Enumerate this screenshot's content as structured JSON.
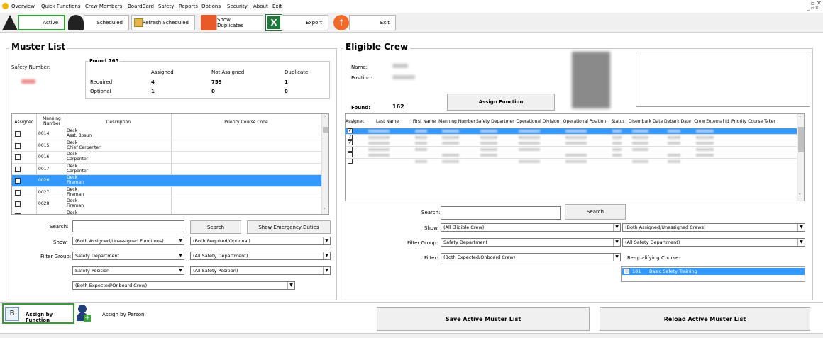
{
  "menu": {
    "items": [
      "Overview",
      "Quick Functions",
      "Crew Members",
      "BoardCard",
      "Safety",
      "Reports",
      "Options",
      "Security",
      "About",
      "Exit"
    ]
  },
  "toolbar": {
    "active_label": "Active",
    "scheduled_label": "Scheduled",
    "refresh_label": "Refresh Scheduled",
    "duplicates_label": "Show Duplicates",
    "export_label": "Export",
    "exit_label": "Exit"
  },
  "muster": {
    "title": "Muster List",
    "safety_number_label": "Safety Number:",
    "found_label": "Found 765",
    "stats": {
      "col_assigned": "Assigned",
      "col_not_assigned": "Not Assigned",
      "col_duplicate": "Duplicate",
      "row_required": "Required",
      "row_optional": "Optional",
      "req_assigned": "4",
      "req_not_assigned": "759",
      "req_duplicate": "1",
      "opt_assigned": "1",
      "opt_not_assigned": "0",
      "opt_duplicate": "0"
    },
    "table": {
      "col_assigned": "Assigned",
      "col_manning": "Manning Number",
      "col_description": "Description",
      "col_priority": "Priority Course Code",
      "rows": [
        {
          "num": "0014",
          "line1": "Deck",
          "line2": "Asst. Bosun",
          "selected": false
        },
        {
          "num": "0015",
          "line1": "Deck",
          "line2": "Chief Carpenter",
          "selected": false
        },
        {
          "num": "0016",
          "line1": "Deck",
          "line2": "Carpenter",
          "selected": false
        },
        {
          "num": "0017",
          "line1": "Deck",
          "line2": "Carpenter",
          "selected": false
        },
        {
          "num": "0026",
          "line1": "Deck",
          "line2": "Fireman",
          "selected": true
        },
        {
          "num": "0027",
          "line1": "Deck",
          "line2": "Fireman",
          "selected": false
        },
        {
          "num": "0028",
          "line1": "Deck",
          "line2": "Fireman",
          "selected": false
        },
        {
          "num": "",
          "line1": "Deck",
          "line2": "",
          "selected": false
        }
      ]
    },
    "search_label": "Search:",
    "search_button": "Search",
    "emergency_button": "Show Emergency Duties",
    "show_label": "Show:",
    "show_value1": "(Both Assigned/Unassigned Functions)",
    "show_value2": "(Both Required/Optional)",
    "filter_group_label": "Filter Group:",
    "filter_value1": "Safety Department",
    "filter_value2": "(All Safety Department)",
    "filter_value3": "Safety Position",
    "filter_value4": "(All Safety Position)",
    "filter_value5": "(Both Expected/Onboard Crew)"
  },
  "crew": {
    "title": "Eligible Crew",
    "name_label": "Name:",
    "position_label": "Position:",
    "found_label": "Found:",
    "found_value": "162",
    "assign_button": "Assign Function",
    "columns": [
      "Assigned",
      "Last Name",
      "First Name",
      "Manning Number",
      "Safety Department",
      "Operational Division",
      "Operational Position",
      "Status",
      "Disembark Date",
      "Debark Date",
      "Crew External Id",
      "Priority Course Taken"
    ],
    "rows": [
      {
        "checked": true,
        "selected": true
      },
      {
        "checked": true,
        "selected": false
      },
      {
        "checked": true,
        "selected": false
      },
      {
        "checked": false,
        "selected": false
      },
      {
        "checked": false,
        "selected": false
      },
      {
        "checked": false,
        "selected": false
      }
    ],
    "search_label": "Search:",
    "search_button": "Search",
    "show_label": "Show:",
    "show_value1": "(All Eligible Crew)",
    "show_value2": "(Both Assigned/Unassigned Crews)",
    "filter_group_label": "Filter Group:",
    "filter_value1": "Safety Department",
    "filter_value2": "(All Safety Department)",
    "filter_label": "Filter:",
    "filter_value3": "(Both Expected/Onboard Crew)",
    "requalifying_label": "Re-qualifying Course:",
    "course_code": "181",
    "course_name": "Basic Safety Training"
  },
  "bottom": {
    "assign_function_label": "Assign by Function",
    "assign_person_label": "Assign by Person",
    "save_button": "Save Active Muster List",
    "reload_button": "Reload Active Muster List"
  },
  "colors": {
    "selection": "#3399ff",
    "active_border": "#3a9a3a"
  }
}
